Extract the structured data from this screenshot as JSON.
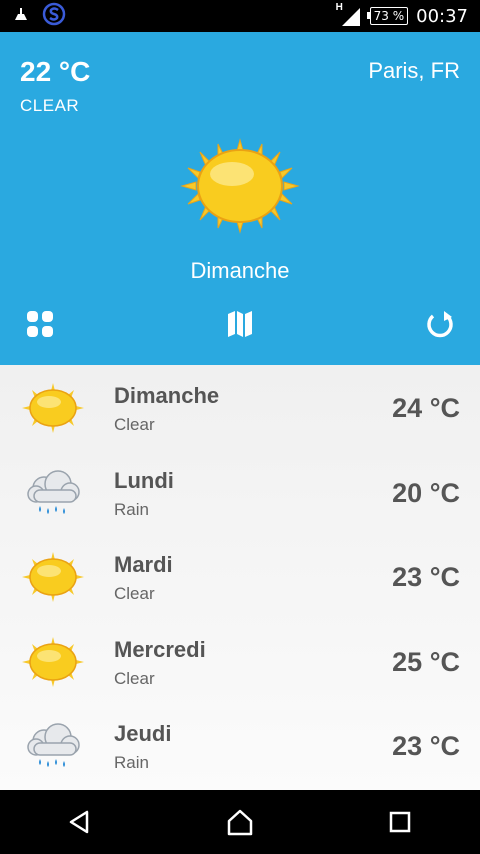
{
  "status_bar": {
    "time": "00:37",
    "battery": "73 %",
    "network_label": "H",
    "icons": [
      "cleaner-icon",
      "app-s-icon",
      "signal-icon",
      "battery-icon"
    ]
  },
  "current": {
    "temperature": "22 °C",
    "condition": "CLEAR",
    "city": "Paris, FR",
    "day": "Dimanche",
    "icon": "sun-icon"
  },
  "toolbar": {
    "icons": [
      "grid-icon",
      "map-icon",
      "refresh-icon"
    ]
  },
  "forecast": [
    {
      "day": "Dimanche",
      "desc": "Clear",
      "temp": "24 °C",
      "icon": "sun-icon"
    },
    {
      "day": "Lundi",
      "desc": "Rain",
      "temp": "20 °C",
      "icon": "rain-cloud-icon"
    },
    {
      "day": "Mardi",
      "desc": "Clear",
      "temp": "23 °C",
      "icon": "sun-icon"
    },
    {
      "day": "Mercredi",
      "desc": "Clear",
      "temp": "25 °C",
      "icon": "sun-icon"
    },
    {
      "day": "Jeudi",
      "desc": "Rain",
      "temp": "23 °C",
      "icon": "rain-cloud-icon"
    }
  ],
  "colors": {
    "header_bg": "#2aa9e0",
    "sun_fill": "#f7c92a",
    "text_dark": "#555555"
  }
}
